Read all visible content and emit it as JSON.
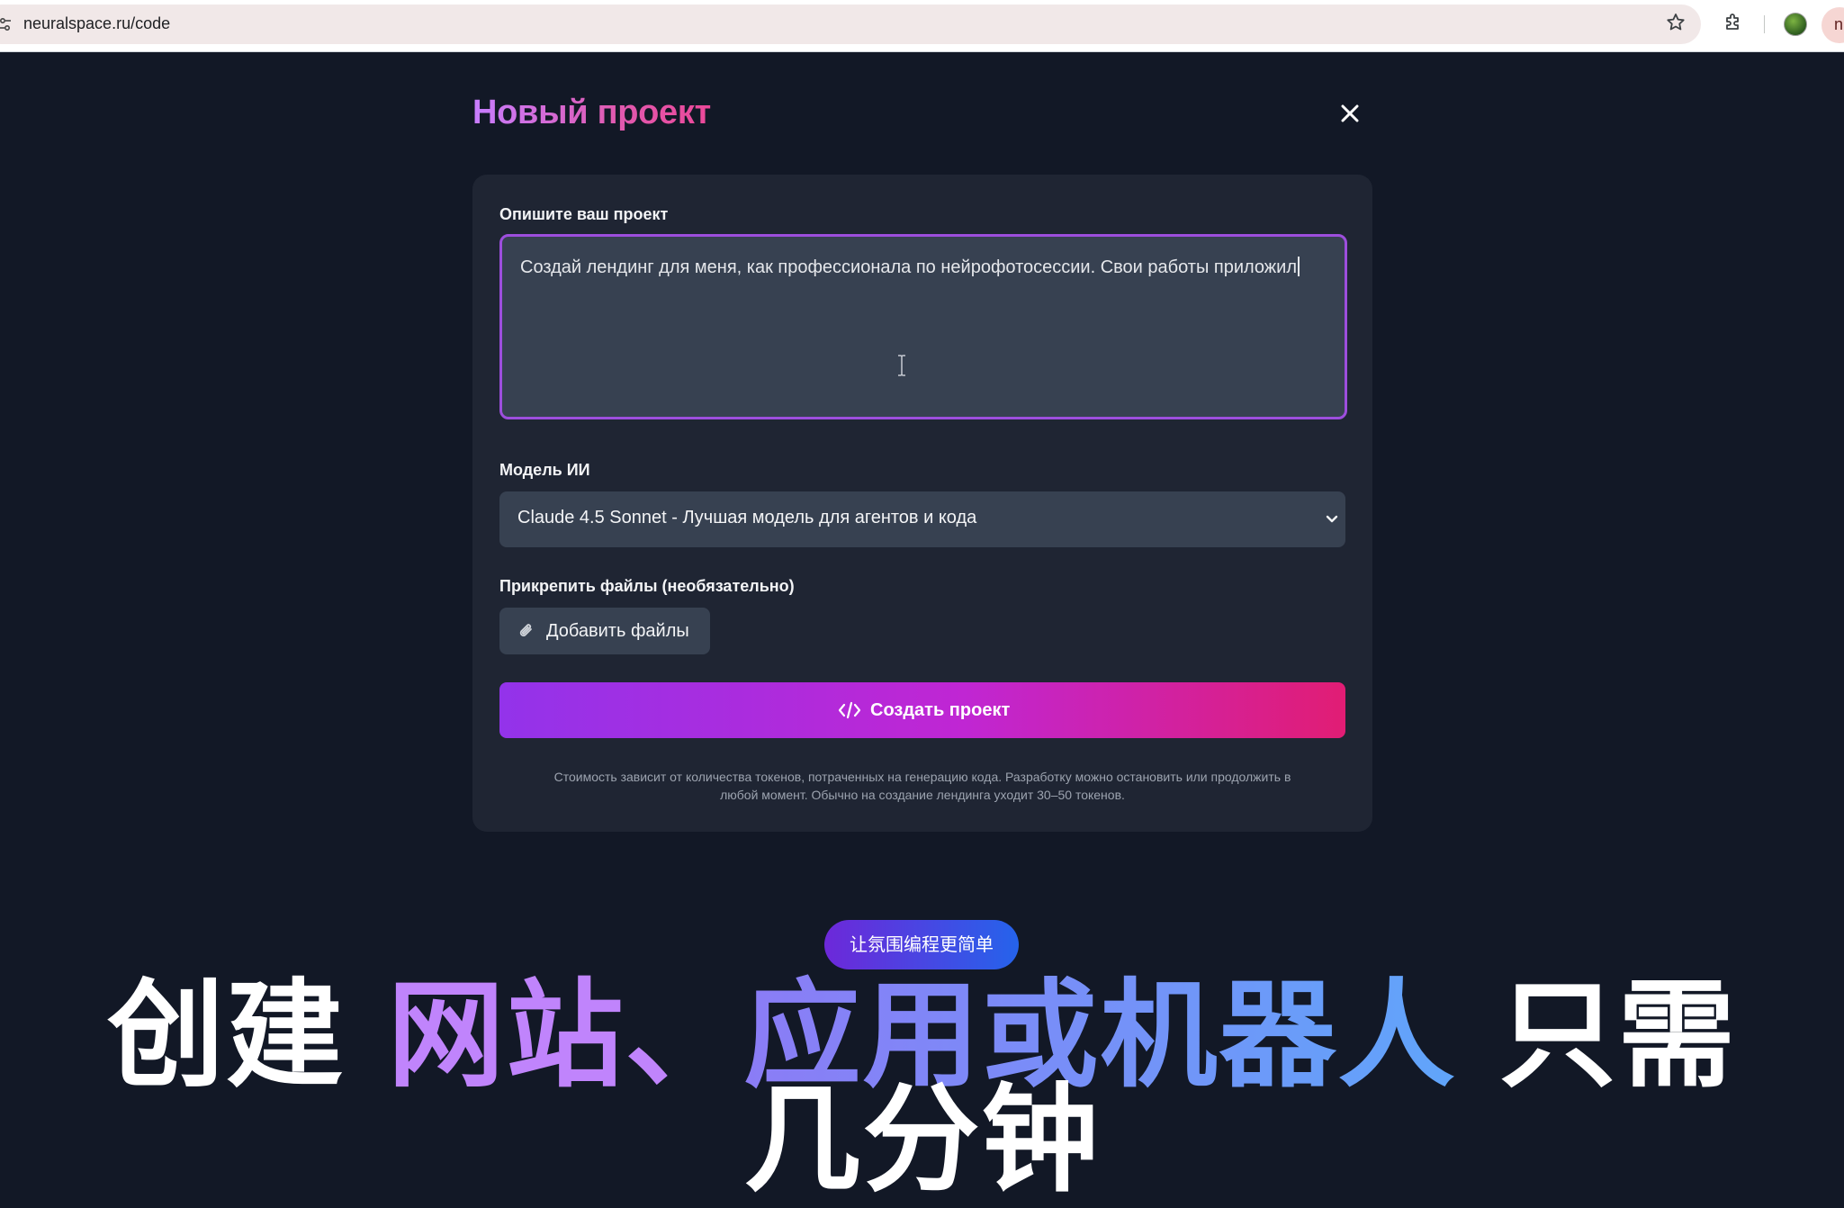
{
  "browser": {
    "url": "neuralspace.ru/code",
    "menu_chip_label": "n"
  },
  "modal": {
    "title": "Новый проект",
    "description_label": "Опишите ваш проект",
    "description_value": "Создай лендинг для меня, как профессионала по нейрофотосессии. Свои работы приложил",
    "model_label": "Модель ИИ",
    "model_selected": "Claude 4.5 Sonnet - Лучшая модель для агентов и кода",
    "attach_label": "Прикрепить файлы (необязательно)",
    "add_files_button": "Добавить файлы",
    "create_button": "Создать проект",
    "cost_note_line1": "Стоимость зависит от количества токенов, потраченных на генерацию кода. Разработку можно остановить или продолжить в",
    "cost_note_line2": "любой момент. Обычно на создание лендинга уходит 30–50 токенов."
  },
  "overlay": {
    "pill": "让氛围编程更简单",
    "caption_part1": "创建 ",
    "caption_part2": "网站、",
    "caption_part3": "应用或机器人",
    "caption_part4": " 只需",
    "caption_line2": "几分钟"
  },
  "colors": {
    "background": "#121826",
    "card": "#1f2533",
    "input": "#374151",
    "accent_purple": "#9333ea",
    "accent_pink": "#e11d74",
    "focus_border": "#9d4edd"
  }
}
